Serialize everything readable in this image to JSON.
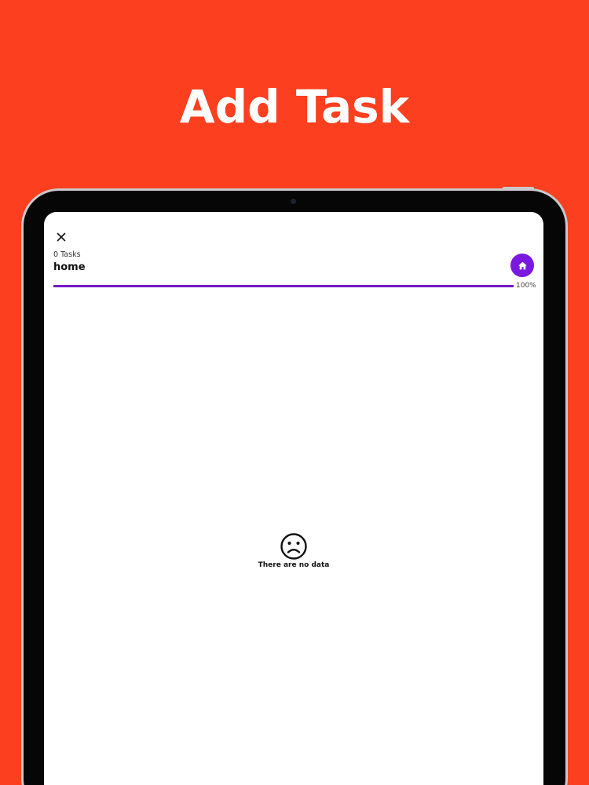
{
  "promo": {
    "headline": "Add Task",
    "background_color": "#fc3f1f"
  },
  "screen": {
    "close_icon": "close-icon",
    "task_count": "0 Tasks",
    "list_title": "home",
    "home_button_icon": "home-icon",
    "accent_color": "#7a18e0",
    "progress": {
      "value_percent": 100,
      "label": "100%"
    },
    "empty_state": {
      "icon": "sad-face-icon",
      "message": "There are no data"
    }
  }
}
